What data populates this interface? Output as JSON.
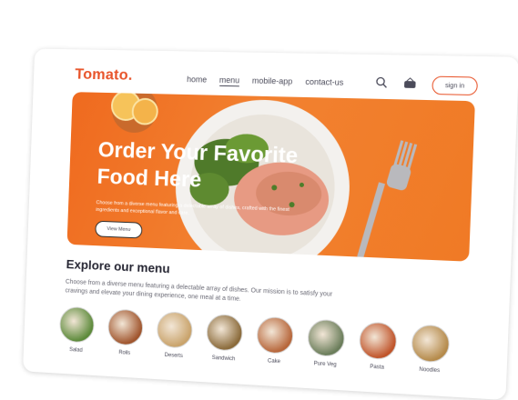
{
  "header": {
    "logo": "Tomato.",
    "nav": [
      "home",
      "menu",
      "mobile-app",
      "contact-us"
    ],
    "active_nav": "menu",
    "signin_label": "sign in"
  },
  "hero": {
    "title": "Order Your Favorite Food Here",
    "subtitle": "Choose from a diverse menu featuring a delectable array of dishes, crafted with the finest ingredients and exceptional flavor and care.",
    "button_label": "View Menu",
    "bg_color": "#f07a25"
  },
  "explore": {
    "title": "Explore our menu",
    "text": "Choose from a diverse menu featuring a delectable array of dishes. Our mission is to satisfy your cravings and elevate your dining experience, one meal at a time."
  },
  "menu_items": [
    {
      "label": "Salad",
      "color": "#5c8a3a"
    },
    {
      "label": "Rolls",
      "color": "#a0552d"
    },
    {
      "label": "Deserts",
      "color": "#c9a36b"
    },
    {
      "label": "Sandwich",
      "color": "#8a6a3a"
    },
    {
      "label": "Cake",
      "color": "#b7663a"
    },
    {
      "label": "Pure Veg",
      "color": "#6a7d5a"
    },
    {
      "label": "Pasta",
      "color": "#c0542a"
    },
    {
      "label": "Noodles",
      "color": "#b58a4a"
    }
  ],
  "colors": {
    "accent": "#e8542a",
    "text": "#4b4b5a"
  }
}
